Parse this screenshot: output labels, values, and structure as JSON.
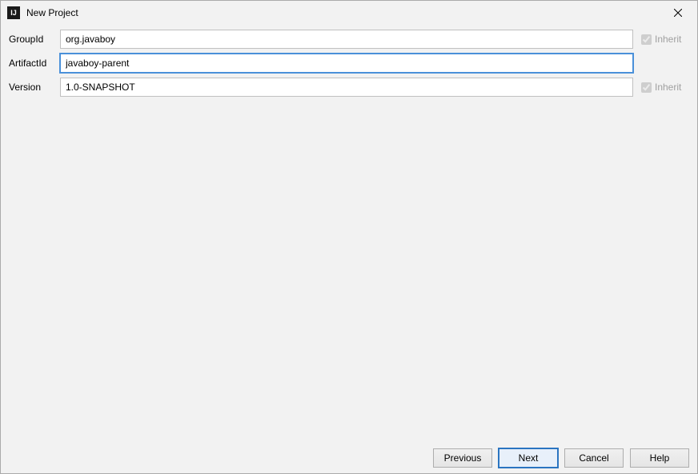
{
  "window": {
    "title": "New Project",
    "icon_text": "IJ"
  },
  "form": {
    "groupId": {
      "label": "GroupId",
      "value": "org.javaboy",
      "inherit_label": "Inherit",
      "inherit_checked": true
    },
    "artifactId": {
      "label": "ArtifactId",
      "value": "javaboy-parent"
    },
    "version": {
      "label": "Version",
      "value": "1.0-SNAPSHOT",
      "inherit_label": "Inherit",
      "inherit_checked": true
    }
  },
  "buttons": {
    "previous": "Previous",
    "next": "Next",
    "cancel": "Cancel",
    "help": "Help"
  }
}
